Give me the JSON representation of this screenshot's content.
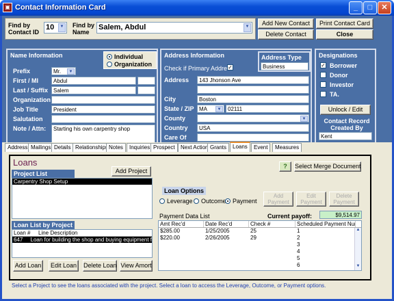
{
  "window": {
    "title": "Contact Information Card",
    "min": "_",
    "max": "□",
    "close": "✕"
  },
  "top": {
    "find_id_label": "Find by Contact ID",
    "find_id_value": "10",
    "find_name_label": "Find by Name",
    "find_name_value": "Salem, Abdul",
    "add_contact": "Add New Contact",
    "delete_contact": "Delete Contact",
    "print_card": "Print Contact Card",
    "close": "Close"
  },
  "name": {
    "header": "Name Information",
    "individual": "Individual",
    "organization_opt": "Organization",
    "prefix_label": "Prefix",
    "prefix": "Mr.",
    "first_label": "First / MI",
    "first": "Abdul",
    "last_label": "Last / Suffix",
    "last": "Salem",
    "org_label": "Organization",
    "org": "",
    "job_label": "Job Title",
    "job": "President",
    "sal_label": "Salutation",
    "sal": "",
    "note_label": "Note / Attn:",
    "note": "Starting his own carpentry shop"
  },
  "address": {
    "header": "Address Information",
    "type_label": "Address Type",
    "type": "Business",
    "primary_label": "Check if Primary Address",
    "address_label": "Address",
    "address1": "143 Jhonson Ave",
    "address2": "",
    "city_label": "City",
    "city": "Boston",
    "statezip_label": "State / ZIP",
    "state": "MA",
    "zip": "02111",
    "county_label": "County",
    "county": "",
    "country_label": "Country",
    "country": "USA",
    "careof_label": "Care Of",
    "careof": ""
  },
  "designations": {
    "header": "Designations",
    "borrower": "Borrower",
    "donor": "Donor",
    "investor": "Investor",
    "ta": "TA.",
    "unlock": "Unlock / Edit",
    "created_label": "Contact Record Created By",
    "created_by": "Kent"
  },
  "tabs": [
    "Address",
    "Mailings",
    "Details",
    "Relationships",
    "Notes",
    "Inquiries",
    "Prospect",
    "Next Action",
    "Grants",
    "Loans",
    "Event",
    "Measures"
  ],
  "loans": {
    "title": "Loans",
    "project_list_label": "Project List",
    "add_project": "Add Project",
    "help": "?",
    "select_merge": "Select Merge Document",
    "projects": [
      "Carpentry Shop Setup"
    ],
    "options_label": "Loan Options",
    "leverage": "Leverage",
    "outcome": "Outcome",
    "payment": "Payment",
    "add_payment": "Add Payment",
    "edit_payment": "Edit Payment",
    "delete_payment": "Delete Payment",
    "payment_list_label": "Payment Data List",
    "current_payoff_label": "Current payoff:",
    "current_payoff": "$9,514.97",
    "loan_list_label": "Loan List by Project",
    "loan_cols": [
      "Loan #",
      "Line Description"
    ],
    "loan_rows": [
      [
        "647",
        "Loan for building the shop and buying equipment f"
      ]
    ],
    "payment_cols": [
      "Amt Rec'd",
      "Date Rec'd",
      "Check #",
      "Scheduled Payment Num"
    ],
    "payment_rows": [
      [
        "$285.00",
        "1/25/2005",
        "25",
        "1"
      ],
      [
        "$220.00",
        "2/26/2005",
        "29",
        "2"
      ],
      [
        "",
        "",
        "",
        "3"
      ],
      [
        "",
        "",
        "",
        "4"
      ],
      [
        "",
        "",
        "",
        "5"
      ],
      [
        "",
        "",
        "",
        "6"
      ]
    ],
    "add_loan": "Add Loan",
    "edit_loan": "Edit Loan",
    "delete_loan": "Delete Loan",
    "view_amort": "View Amort",
    "hint": "Select a Project to see the loans associated with the project.  Select a loan to access the Leverage, Outcome, or Payment options."
  },
  "colors": {
    "panel": "#4a6fa5",
    "titlebar": "#0a4fd6",
    "accent_tab": "#e68b2c",
    "hint_text": "#1f3fb0"
  }
}
